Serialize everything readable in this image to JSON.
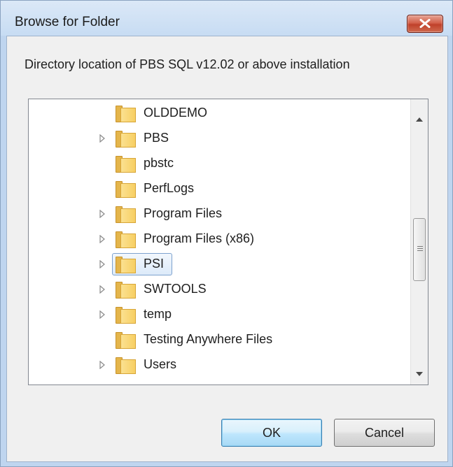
{
  "window": {
    "title": "Browse for Folder",
    "close_icon": "close-x-icon",
    "accent_color": "#c0412b"
  },
  "description": "Directory location of PBS SQL v12.02 or above installation",
  "tree": {
    "selected_label": "PSI",
    "items": [
      {
        "label": "OLDDEMO",
        "expandable": false,
        "icon": "folder-icon"
      },
      {
        "label": "PBS",
        "expandable": true,
        "icon": "folder-icon"
      },
      {
        "label": "pbstc",
        "expandable": false,
        "icon": "folder-icon"
      },
      {
        "label": "PerfLogs",
        "expandable": false,
        "icon": "folder-icon"
      },
      {
        "label": "Program Files",
        "expandable": true,
        "icon": "folder-icon"
      },
      {
        "label": "Program Files (x86)",
        "expandable": true,
        "icon": "folder-icon"
      },
      {
        "label": "PSI",
        "expandable": true,
        "icon": "folder-icon",
        "selected": true
      },
      {
        "label": "SWTOOLS",
        "expandable": true,
        "icon": "folder-icon"
      },
      {
        "label": "temp",
        "expandable": true,
        "icon": "folder-icon"
      },
      {
        "label": "Testing Anywhere Files",
        "expandable": false,
        "icon": "folder-icon"
      },
      {
        "label": "Users",
        "expandable": true,
        "icon": "folder-icon"
      }
    ]
  },
  "buttons": {
    "ok_label": "OK",
    "cancel_label": "Cancel"
  }
}
